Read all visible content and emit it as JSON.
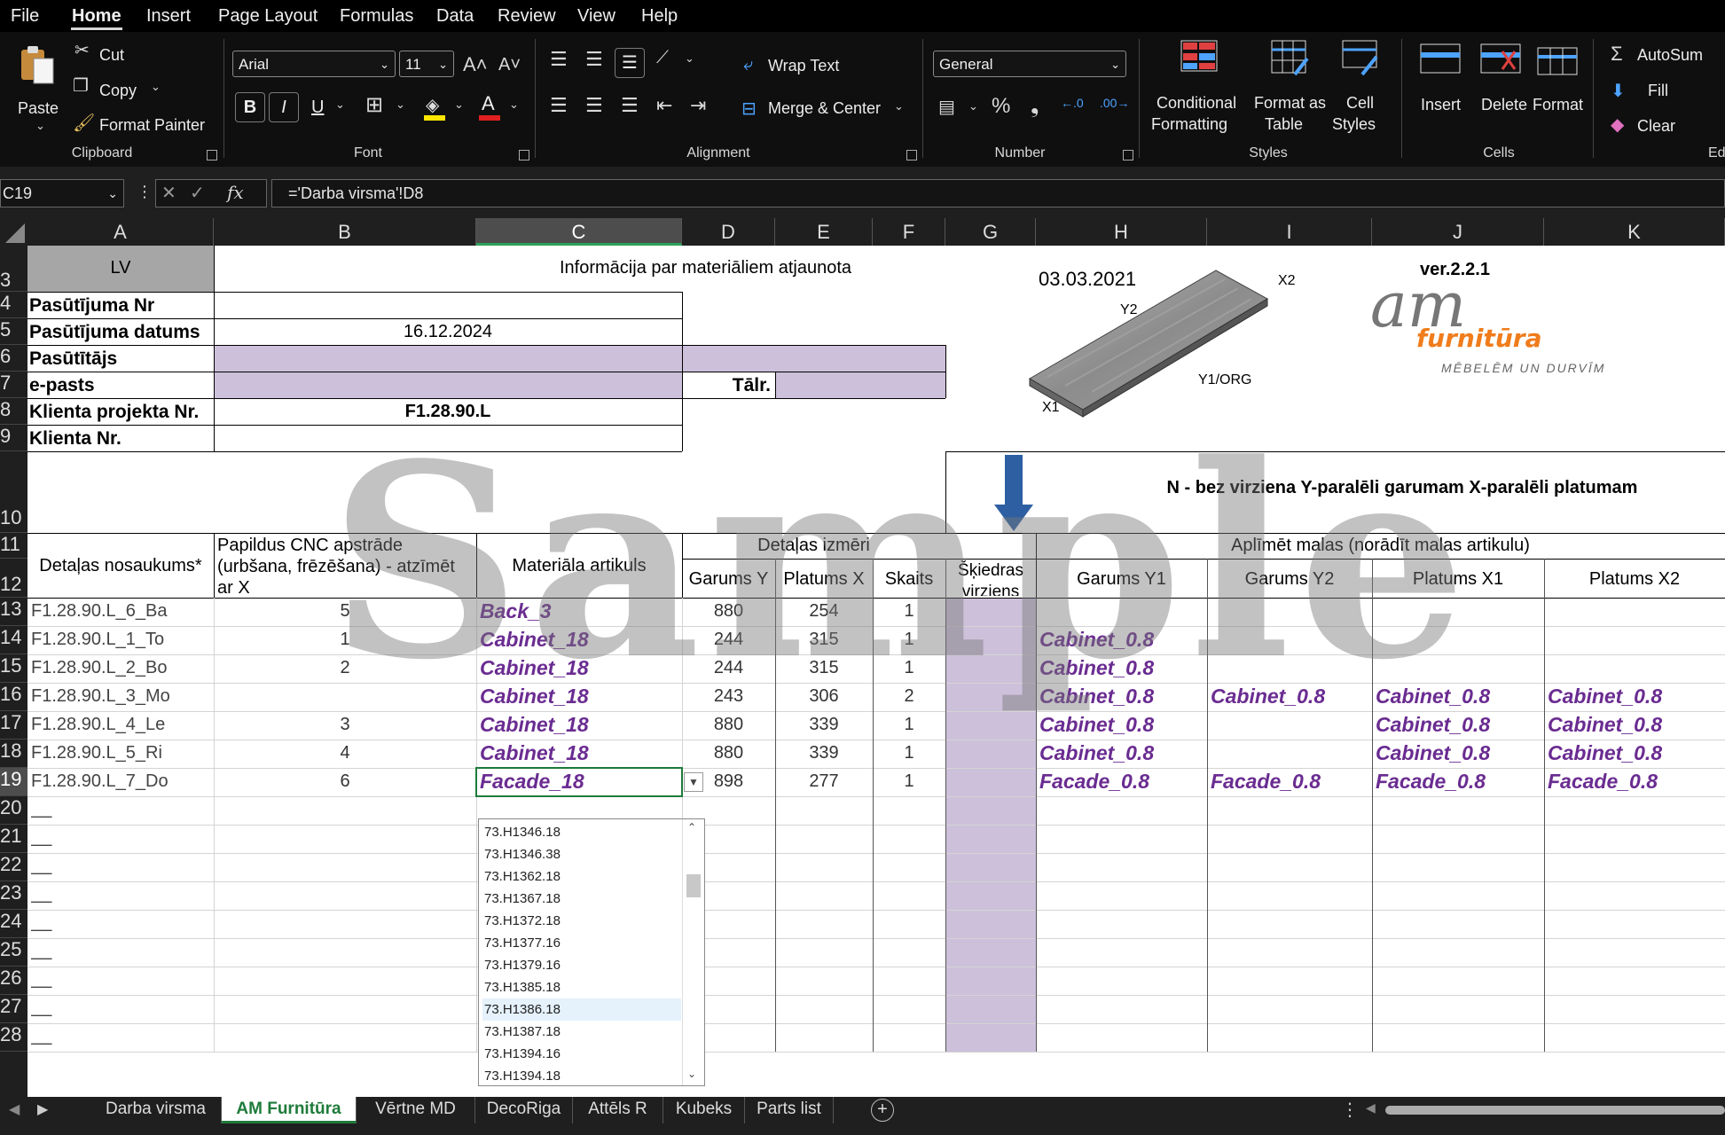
{
  "menu": {
    "items": [
      "File",
      "Home",
      "Insert",
      "Page Layout",
      "Formulas",
      "Data",
      "Review",
      "View",
      "Help"
    ]
  },
  "ribbon": {
    "clipboard": {
      "paste": "Paste",
      "cut": "Cut",
      "copy": "Copy",
      "format_painter": "Format Painter",
      "label": "Clipboard"
    },
    "font": {
      "name": "Arial",
      "size": "11",
      "bold": "B",
      "italic": "I",
      "underline": "U",
      "label": "Font"
    },
    "alignment": {
      "wrap_text": "Wrap Text",
      "merge_center": "Merge & Center",
      "label": "Alignment"
    },
    "number": {
      "format": "General",
      "label": "Number"
    },
    "styles": {
      "conditional": "Conditional",
      "conditional2": "Formatting",
      "format_as": "Format as",
      "format_as2": "Table",
      "cell": "Cell",
      "cell2": "Styles",
      "label": "Styles"
    },
    "cells": {
      "insert": "Insert",
      "delete": "Delete",
      "format": "Format",
      "label": "Cells"
    },
    "editing": {
      "autosum": "AutoSum",
      "fill": "Fill",
      "clear": "Clear",
      "label": "Ed"
    }
  },
  "formula_bar": {
    "name_box": "C19",
    "formula": "='Darba virsma'!D8"
  },
  "columns": [
    "A",
    "B",
    "C",
    "D",
    "E",
    "F",
    "G",
    "H",
    "I",
    "J",
    "K"
  ],
  "rows": [
    "3",
    "4",
    "5",
    "6",
    "7",
    "8",
    "9",
    "10",
    "11",
    "12",
    "13",
    "14",
    "15",
    "16",
    "17",
    "18",
    "19",
    "20",
    "21",
    "22",
    "23",
    "24",
    "25",
    "26",
    "27",
    "28"
  ],
  "sheet": {
    "lv": "LV",
    "info": "Informācija par materiāliem atjaunota",
    "date": "03.03.2021",
    "version": "ver.2.2.1",
    "logo_am": "am",
    "logo_brand": "furnitūra",
    "logo_tagline": "MĒBELĒM UN DURVĪM",
    "board_labels": {
      "x2": "X2",
      "y2": "Y2",
      "y1": "Y1/ORG",
      "x1": "X1"
    },
    "order_no_label": "Pasūtījuma Nr",
    "order_date_label": "Pasūtījuma datums",
    "order_date": "16.12.2024",
    "customer_label": "Pasūtītājs",
    "email_label": "e-pasts",
    "phone_label": "Tālr.",
    "project_label": "Klienta projekta Nr.",
    "project_value": "F1.28.90.L",
    "client_label": "Klienta Nr.",
    "grain_note": "N - bez virziena  Y-paralēli garumam  X-paralēli platumam",
    "watermark": "Sample",
    "headers": {
      "name": "Detaļas nosaukums*",
      "cnc": "Papildus CNC apstrāde (urbšana, frēzēšana) - atzīmēt ar X",
      "material": "Materiāla artikuls",
      "dims": "Detaļas izmēri",
      "length": "Garums Y",
      "width": "Platums X",
      "count": "Skaits",
      "grain": "Šķiedras virziens",
      "edges": "Aplīmēt malas (norādīt malas artikulu)",
      "edge_y1": "Garums Y1",
      "edge_y2": "Garums Y2",
      "edge_x1": "Platums X1",
      "edge_x2": "Platums X2"
    },
    "data_rows": [
      {
        "name": "F1.28.90.L_6_Ba",
        "cnc": "5",
        "mat": "Back_3",
        "len": "880",
        "wid": "254",
        "cnt": "1",
        "y1": "",
        "y2": "",
        "x1": "",
        "x2": ""
      },
      {
        "name": "F1.28.90.L_1_To",
        "cnc": "1",
        "mat": "Cabinet_18",
        "len": "244",
        "wid": "315",
        "cnt": "1",
        "y1": "Cabinet_0.8",
        "y2": "",
        "x1": "",
        "x2": ""
      },
      {
        "name": "F1.28.90.L_2_Bo",
        "cnc": "2",
        "mat": "Cabinet_18",
        "len": "244",
        "wid": "315",
        "cnt": "1",
        "y1": "Cabinet_0.8",
        "y2": "",
        "x1": "",
        "x2": ""
      },
      {
        "name": "F1.28.90.L_3_Mo",
        "cnc": "",
        "mat": "Cabinet_18",
        "len": "243",
        "wid": "306",
        "cnt": "2",
        "y1": "Cabinet_0.8",
        "y2": "Cabinet_0.8",
        "x1": "Cabinet_0.8",
        "x2": "Cabinet_0.8"
      },
      {
        "name": "F1.28.90.L_4_Le",
        "cnc": "3",
        "mat": "Cabinet_18",
        "len": "880",
        "wid": "339",
        "cnt": "1",
        "y1": "Cabinet_0.8",
        "y2": "",
        "x1": "Cabinet_0.8",
        "x2": "Cabinet_0.8"
      },
      {
        "name": "F1.28.90.L_5_Ri",
        "cnc": "4",
        "mat": "Cabinet_18",
        "len": "880",
        "wid": "339",
        "cnt": "1",
        "y1": "Cabinet_0.8",
        "y2": "",
        "x1": "Cabinet_0.8",
        "x2": "Cabinet_0.8"
      },
      {
        "name": "F1.28.90.L_7_Do",
        "cnc": "6",
        "mat": "Facade_18",
        "len": "898",
        "wid": "277",
        "cnt": "1",
        "y1": "Facade_0.8",
        "y2": "Facade_0.8",
        "x1": "Facade_0.8",
        "x2": "Facade_0.8"
      }
    ],
    "empty_name": "__"
  },
  "dropdown": {
    "items": [
      "73.H1346.18",
      "73.H1346.38",
      "73.H1362.18",
      "73.H1367.18",
      "73.H1372.18",
      "73.H1377.16",
      "73.H1379.16",
      "73.H1385.18",
      "73.H1386.18",
      "73.H1387.18",
      "73.H1394.16",
      "73.H1394.18"
    ],
    "highlighted": "73.H1386.18"
  },
  "tabs": [
    "Darba virsma",
    "AM Furnitūra",
    "Vērtne  MD",
    "DecoRiga",
    "Attēls R",
    "Kubeks",
    "Parts list"
  ],
  "active_tab": "AM Furnitūra",
  "colors": {
    "accent_green": "#1e7b3a",
    "input_purple": "#ccc0da",
    "material_purple": "#6a2c91",
    "logo_orange": "#f07c1b"
  }
}
